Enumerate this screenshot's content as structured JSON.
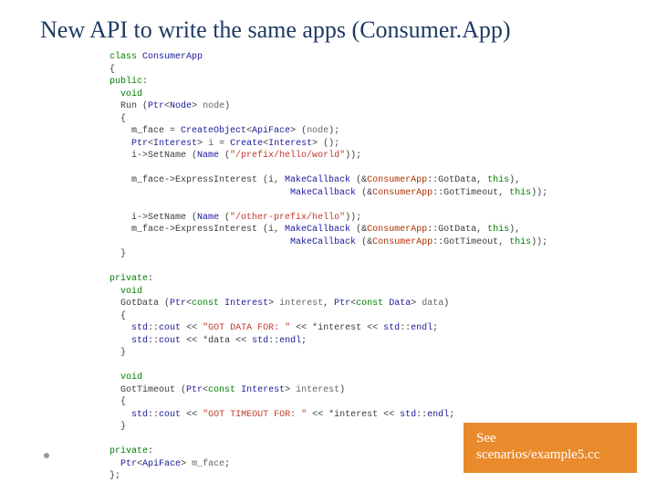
{
  "title": "New API to write the same apps (Consumer.App)",
  "callout": {
    "line1": "See",
    "line2": "scenarios/example5.cc"
  },
  "code": {
    "l01_kw": "class",
    "l01_name": " ConsumerApp",
    "l02": "{",
    "l03_kw": "public",
    "l03_rest": ":",
    "l04_kw": "  void",
    "l05_a": "  Run (",
    "l05_t": "Ptr",
    "l05_b": "<",
    "l05_t2": "Node",
    "l05_c": "> ",
    "l05_v": "node",
    "l05_d": ")",
    "l06": "  {",
    "l07_a": "    m_face = ",
    "l07_t": "CreateObject",
    "l07_b": "<",
    "l07_t2": "ApiFace",
    "l07_c": "> (",
    "l07_v": "node",
    "l07_d": ");",
    "l08_a": "    ",
    "l08_t": "Ptr",
    "l08_b": "<",
    "l08_t2": "Interest",
    "l08_c": "> ",
    "l08_v": "i",
    "l08_d": " = ",
    "l08_t3": "Create",
    "l08_e": "<",
    "l08_t4": "Interest",
    "l08_f": "> ();",
    "l09_a": "    i->SetName (",
    "l09_t": "Name",
    "l09_b": " (",
    "l09_s": "\"/prefix/hello/world\"",
    "l09_c": "));",
    "l10": "",
    "l11_a": "    m_face->ExpressInterest (i, ",
    "l11_t": "MakeCallback",
    "l11_b": " (&",
    "l11_cls": "ConsumerApp",
    "l11_c": "::GotData, ",
    "l11_kw": "this",
    "l11_d": "),",
    "l12_a": "                                 ",
    "l12_t": "MakeCallback",
    "l12_b": " (&",
    "l12_cls": "ConsumerApp",
    "l12_c": "::GotTimeout, ",
    "l12_kw": "this",
    "l12_d": "));",
    "l13": "",
    "l14_a": "    i->SetName (",
    "l14_t": "Name",
    "l14_b": " (",
    "l14_s": "\"/other-prefix/hello\"",
    "l14_c": "));",
    "l15_a": "    m_face->ExpressInterest (i, ",
    "l15_t": "MakeCallback",
    "l15_b": " (&",
    "l15_cls": "ConsumerApp",
    "l15_c": "::GotData, ",
    "l15_kw": "this",
    "l15_d": "),",
    "l16_a": "                                 ",
    "l16_t": "MakeCallback",
    "l16_b": " (&",
    "l16_cls": "ConsumerApp",
    "l16_c": "::GotTimeout, ",
    "l16_kw": "this",
    "l16_d": "));",
    "l17": "  }",
    "l18": "",
    "l19_kw": "private",
    "l19_rest": ":",
    "l20_kw": "  void",
    "l21_a": "  GotData (",
    "l21_t": "Ptr",
    "l21_b": "<",
    "l21_kw": "const",
    "l21_c": " ",
    "l21_t2": "Interest",
    "l21_d": "> ",
    "l21_v": "interest",
    "l21_e": ", ",
    "l21_t3": "Ptr",
    "l21_f": "<",
    "l21_kw2": "const",
    "l21_g": " ",
    "l21_t4": "Data",
    "l21_h": "> ",
    "l21_v2": "data",
    "l21_i": ")",
    "l22": "  {",
    "l23_a": "    ",
    "l23_t": "std",
    "l23_b": "::",
    "l23_t2": "cout",
    "l23_c": " << ",
    "l23_s": "\"GOT DATA FOR: \"",
    "l23_d": " << *interest << ",
    "l23_t3": "std",
    "l23_e": "::",
    "l23_t4": "endl",
    "l23_f": ";",
    "l24_a": "    ",
    "l24_t": "std",
    "l24_b": "::",
    "l24_t2": "cout",
    "l24_c": " << *data << ",
    "l24_t3": "std",
    "l24_d": "::",
    "l24_t4": "endl",
    "l24_e": ";",
    "l25": "  }",
    "l26": "",
    "l27_kw": "  void",
    "l28_a": "  GotTimeout (",
    "l28_t": "Ptr",
    "l28_b": "<",
    "l28_kw": "const",
    "l28_c": " ",
    "l28_t2": "Interest",
    "l28_d": "> ",
    "l28_v": "interest",
    "l28_e": ")",
    "l29": "  {",
    "l30_a": "    ",
    "l30_t": "std",
    "l30_b": "::",
    "l30_t2": "cout",
    "l30_c": " << ",
    "l30_s": "\"GOT TIMEOUT FOR: \"",
    "l30_d": " << *interest << ",
    "l30_t3": "std",
    "l30_e": "::",
    "l30_t4": "endl",
    "l30_f": ";",
    "l31": "  }",
    "l32": "",
    "l33_kw": "private",
    "l33_rest": ":",
    "l34_a": "  ",
    "l34_t": "Ptr",
    "l34_b": "<",
    "l34_t2": "ApiFace",
    "l34_c": "> ",
    "l34_v": "m_face",
    "l34_d": ";",
    "l35": "};"
  }
}
